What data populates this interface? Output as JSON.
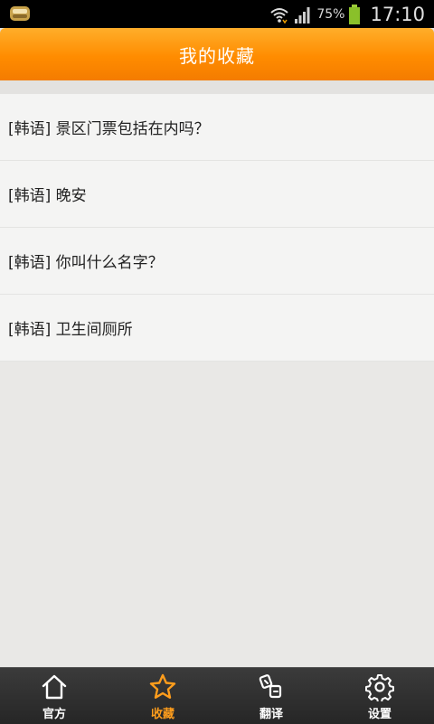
{
  "status_bar": {
    "battery_pct": "75%",
    "time": "17:10"
  },
  "header": {
    "title": "我的收藏"
  },
  "favorites": [
    {
      "text": "[韩语] 景区门票包括在内吗？"
    },
    {
      "text": "[韩语] 晚安"
    },
    {
      "text": "[韩语] 你叫什么名字？"
    },
    {
      "text": "[韩语] 卫生间厕所"
    }
  ],
  "tabs": [
    {
      "label": "官方",
      "icon": "home-icon",
      "active": false
    },
    {
      "label": "收藏",
      "icon": "star-icon",
      "active": true
    },
    {
      "label": "翻译",
      "icon": "translate-icon",
      "active": false
    },
    {
      "label": "设置",
      "icon": "gear-icon",
      "active": false
    }
  ],
  "colors": {
    "accent": "#ff8c00",
    "active_tab": "#ff9d1c",
    "tabbar_bg": "#2e2e2e"
  }
}
